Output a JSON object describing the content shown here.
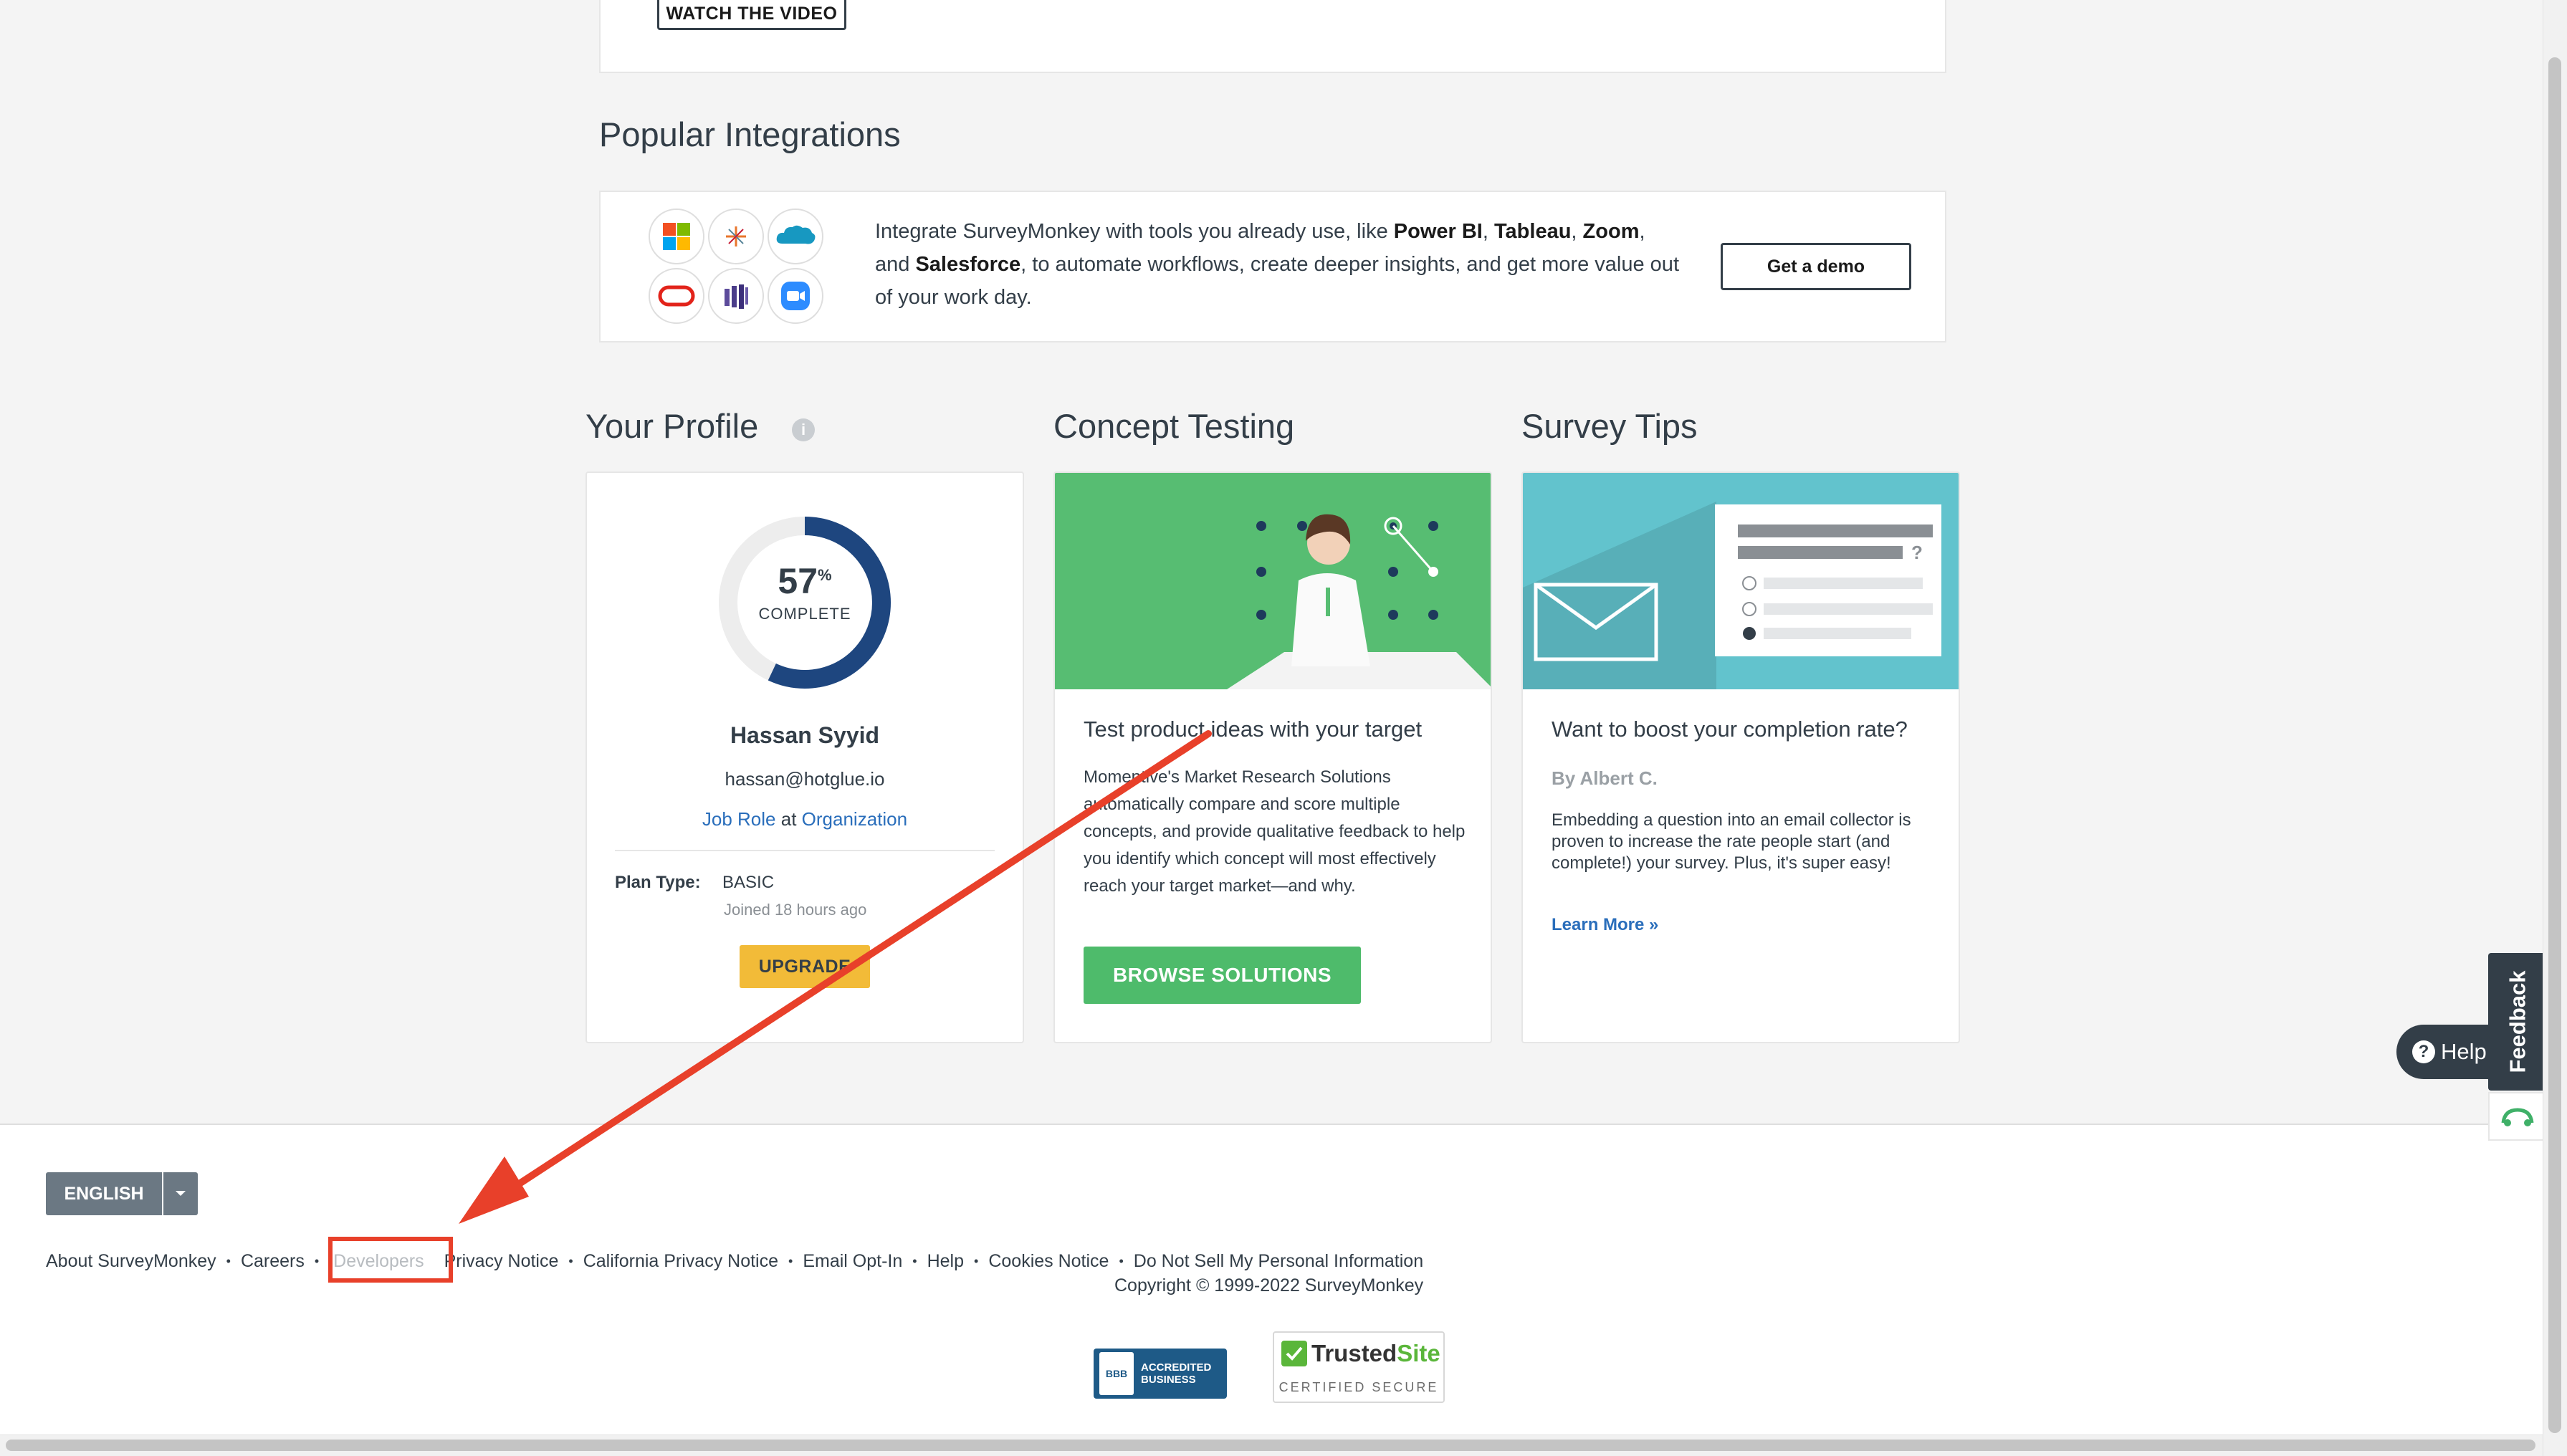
{
  "top_card": {
    "watch_label": "WATCH THE VIDEO"
  },
  "integrations": {
    "title": "Popular Integrations",
    "text_parts": {
      "p1": "Integrate SurveyMonkey with tools you already use, like ",
      "b1": "Power BI",
      "c1": ", ",
      "b2": "Tableau",
      "c2": ", ",
      "b3": "Zoom",
      "p2": ", and ",
      "b4": "Salesforce",
      "p3": ", to automate workflows, create deeper insights, and get more value out of your work day."
    },
    "demo_label": "Get a demo",
    "icons": [
      "microsoft-icon",
      "tableau-icon",
      "salesforce-icon",
      "oracle-icon",
      "powerbi-icon",
      "zoom-icon"
    ]
  },
  "profile": {
    "title": "Your Profile",
    "completion_percent": 57,
    "percent_sign": "%",
    "complete_label": "COMPLETE",
    "name": "Hassan Syyid",
    "email": "hassan@hotglue.io",
    "job_role": "Job Role",
    "at": "at",
    "organization": "Organization",
    "plan_type_label": "Plan Type:",
    "plan_type_value": "BASIC",
    "joined": "Joined 18 hours ago",
    "upgrade_label": "UPGRADE"
  },
  "concept": {
    "title": "Concept Testing",
    "heading": "Test product ideas with your target",
    "body": "Momentive's Market Research Solutions automatically compare and score multiple concepts, and provide qualitative feedback to help you identify which concept will most effectively reach your target market—and why.",
    "button_label": "BROWSE SOLUTIONS"
  },
  "tips": {
    "title": "Survey Tips",
    "heading": "Want to boost your completion rate?",
    "author": "By Albert C.",
    "body": "Embedding a question into an email collector is proven to increase the rate people start (and complete!) your survey. Plus, it's super easy!",
    "learn_more": "Learn More »"
  },
  "footer": {
    "language": "ENGLISH",
    "links": [
      "About SurveyMonkey",
      "Careers",
      "Developers",
      "Privacy Notice",
      "California Privacy Notice",
      "Email Opt-In",
      "Help",
      "Cookies Notice",
      "Do Not Sell My Personal Information"
    ],
    "separator": "•",
    "copyright": "Copyright © 1999-2022 SurveyMonkey",
    "bbb_line1": "ACCREDITED",
    "bbb_line2": "BUSINESS",
    "bbb_mark": "BBB",
    "trusted_title_a": "Trusted",
    "trusted_title_b": "Site",
    "trusted_sub": "CERTIFIED SECURE"
  },
  "widgets": {
    "help_label": "Help",
    "help_q": "?",
    "feedback_label": "Feedback"
  },
  "colors": {
    "annotation_red": "#e8402a",
    "brand_green": "#4ebb6b",
    "upgrade_yellow": "#f2bb38",
    "ring_blue": "#1e467f",
    "link_blue": "#2a6ebb"
  }
}
